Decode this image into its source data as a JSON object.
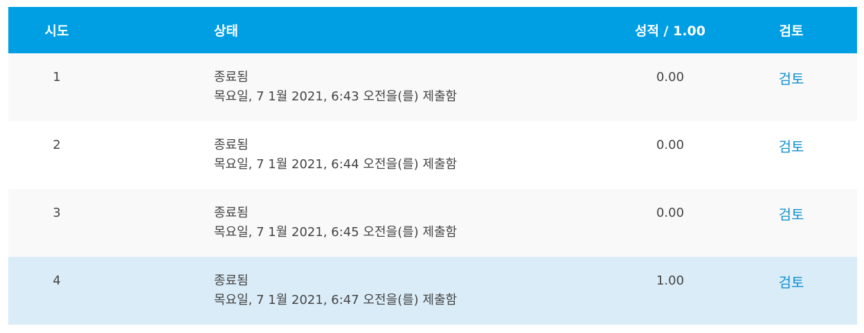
{
  "table": {
    "headers": {
      "attempt": "시도",
      "state": "상태",
      "grade": "성적 / 1.00",
      "review": "검토"
    },
    "rows": [
      {
        "attempt": "1",
        "state": "종료됨",
        "submitted": "목요일, 7 1월 2021, 6:43 오전을(를) 제출함",
        "grade": "0.00",
        "review": "검토"
      },
      {
        "attempt": "2",
        "state": "종료됨",
        "submitted": "목요일, 7 1월 2021, 6:44 오전을(를) 제출함",
        "grade": "0.00",
        "review": "검토"
      },
      {
        "attempt": "3",
        "state": "종료됨",
        "submitted": "목요일, 7 1월 2021, 6:45 오전을(를) 제출함",
        "grade": "0.00",
        "review": "검토"
      },
      {
        "attempt": "4",
        "state": "종료됨",
        "submitted": "목요일, 7 1월 2021, 6:47 오전을(를) 제출함",
        "grade": "1.00",
        "review": "검토"
      }
    ]
  },
  "colors": {
    "header_bg": "#009fe3",
    "row_odd": "#f9f9f9",
    "row_even": "#ffffff",
    "row_highlight": "#d9ecf7",
    "link": "#0f8fd1"
  }
}
